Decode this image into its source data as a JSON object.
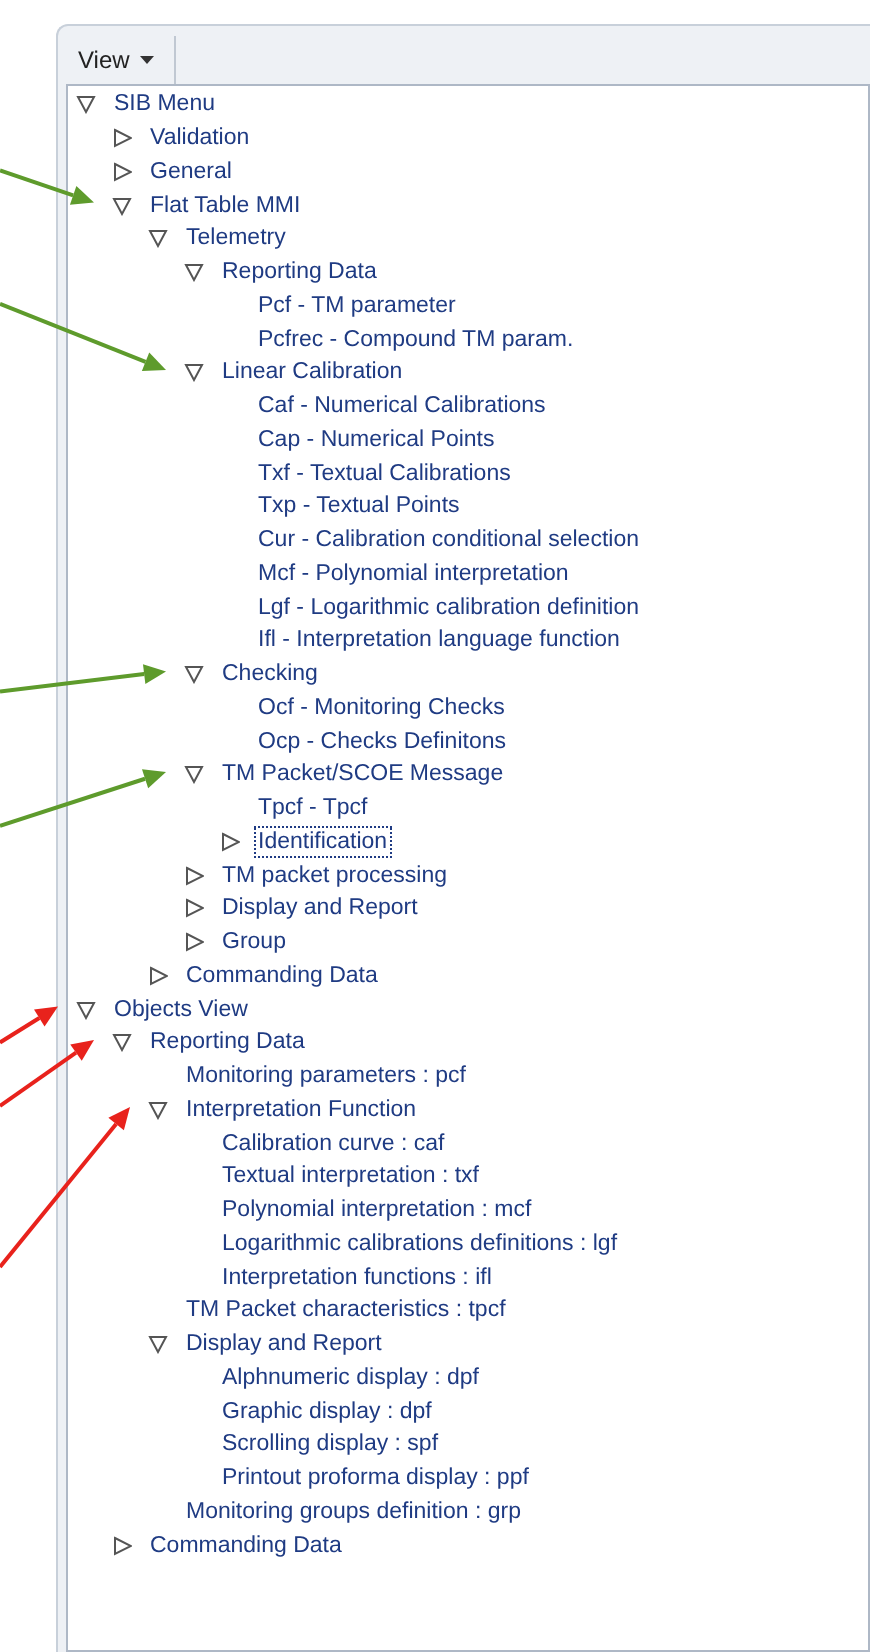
{
  "toolbar": {
    "menu_button": "View"
  },
  "tree": [
    {
      "label": "SIB Menu",
      "expanded": true,
      "selected": false,
      "children": [
        {
          "label": "Validation",
          "expanded": false,
          "selected": false
        },
        {
          "label": "General",
          "expanded": false,
          "selected": false
        },
        {
          "label": "Flat Table MMI",
          "expanded": true,
          "selected": false,
          "arrow": {
            "color": "#5e9b2c"
          },
          "children": [
            {
              "label": "Telemetry",
              "expanded": true,
              "selected": false,
              "children": [
                {
                  "label": "Reporting Data",
                  "expanded": true,
                  "selected": false,
                  "children": [
                    {
                      "label": "Pcf - TM parameter",
                      "selected": false
                    },
                    {
                      "label": "Pcfrec - Compound TM param.",
                      "selected": false
                    }
                  ]
                },
                {
                  "label": "Linear Calibration",
                  "expanded": true,
                  "selected": false,
                  "arrow": {
                    "color": "#5e9b2c"
                  },
                  "children": [
                    {
                      "label": "Caf - Numerical Calibrations",
                      "selected": false
                    },
                    {
                      "label": "Cap - Numerical Points",
                      "selected": false
                    },
                    {
                      "label": "Txf - Textual Calibrations",
                      "selected": false
                    },
                    {
                      "label": "Txp - Textual Points",
                      "selected": false
                    },
                    {
                      "label": "Cur - Calibration conditional selection",
                      "selected": false
                    },
                    {
                      "label": "Mcf - Polynomial interpretation",
                      "selected": false
                    },
                    {
                      "label": "Lgf - Logarithmic calibration definition",
                      "selected": false
                    },
                    {
                      "label": "Ifl - Interpretation language function",
                      "selected": false
                    }
                  ]
                },
                {
                  "label": "Checking",
                  "expanded": true,
                  "selected": false,
                  "arrow": {
                    "color": "#5e9b2c"
                  },
                  "children": [
                    {
                      "label": "Ocf - Monitoring Checks",
                      "selected": false
                    },
                    {
                      "label": "Ocp - Checks Definitons",
                      "selected": false
                    }
                  ]
                },
                {
                  "label": "TM Packet/SCOE Message",
                  "expanded": true,
                  "selected": false,
                  "arrow": {
                    "color": "#5e9b2c"
                  },
                  "children": [
                    {
                      "label": "Tpcf - Tpcf",
                      "selected": false
                    },
                    {
                      "label": "Identification",
                      "expanded": false,
                      "selected": true
                    }
                  ]
                },
                {
                  "label": "TM packet processing",
                  "expanded": false,
                  "selected": false
                },
                {
                  "label": "Display and Report",
                  "expanded": false,
                  "selected": false
                },
                {
                  "label": "Group",
                  "expanded": false,
                  "selected": false
                }
              ]
            },
            {
              "label": "Commanding Data",
              "expanded": false,
              "selected": false
            }
          ]
        }
      ]
    },
    {
      "label": "Objects View",
      "expanded": true,
      "selected": false,
      "arrow": {
        "color": "#e8221c"
      },
      "children": [
        {
          "label": "Reporting Data",
          "expanded": true,
          "selected": false,
          "arrow": {
            "color": "#e8221c"
          },
          "children": [
            {
              "label": "Monitoring parameters : pcf",
              "selected": false
            },
            {
              "label": "Interpretation Function",
              "expanded": true,
              "selected": false,
              "arrow": {
                "color": "#e8221c"
              },
              "children": [
                {
                  "label": "Calibration curve : caf",
                  "selected": false
                },
                {
                  "label": "Textual interpretation : txf",
                  "selected": false
                },
                {
                  "label": "Polynomial interpretation : mcf",
                  "selected": false
                },
                {
                  "label": "Logarithmic calibrations definitions : lgf",
                  "selected": false
                },
                {
                  "label": "Interpretation functions : ifl",
                  "selected": false
                }
              ]
            },
            {
              "label": "TM Packet characteristics : tpcf",
              "selected": false
            },
            {
              "label": "Display and Report",
              "expanded": true,
              "selected": false,
              "children": [
                {
                  "label": "Alphnumeric display : dpf",
                  "selected": false
                },
                {
                  "label": "Graphic display : dpf",
                  "selected": false
                },
                {
                  "label": "Scrolling display : spf",
                  "selected": false
                },
                {
                  "label": "Printout proforma display : ppf",
                  "selected": false
                }
              ]
            },
            {
              "label": "Monitoring groups definition : grp",
              "selected": false
            }
          ]
        },
        {
          "label": "Commanding Data",
          "expanded": false,
          "selected": false
        }
      ]
    }
  ]
}
